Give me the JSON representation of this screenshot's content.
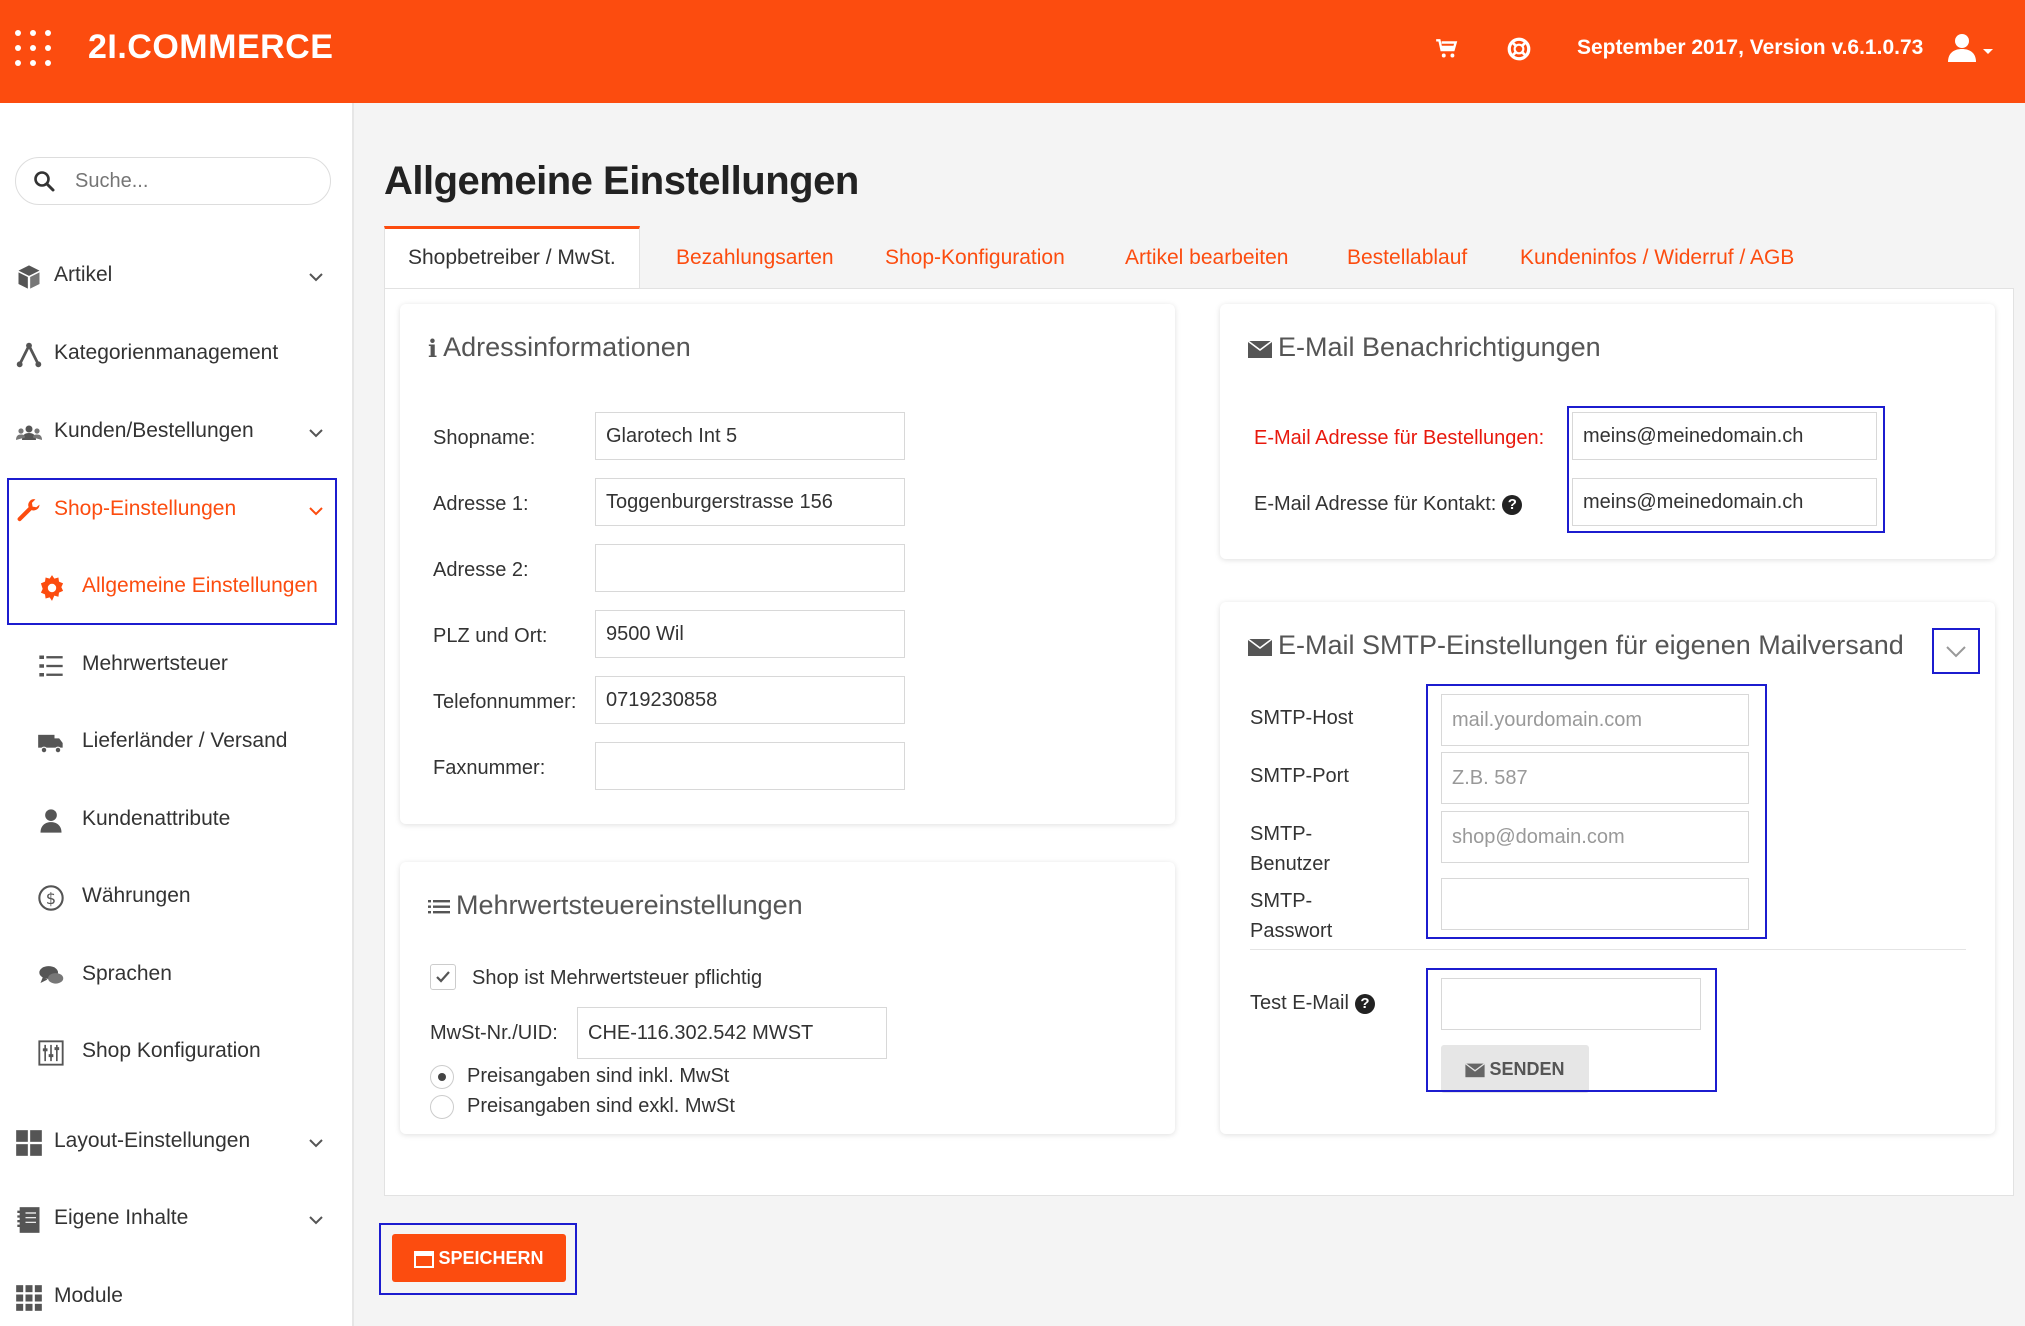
{
  "header": {
    "brand": "2I.COMMERCE",
    "version": "September 2017, Version v.6.1.0.73",
    "icons": [
      "grid-menu-icon",
      "cart-icon",
      "support-icon",
      "user-icon"
    ]
  },
  "sidebar": {
    "search_placeholder": "Suche...",
    "items": [
      {
        "label": "Artikel",
        "icon": "box-icon",
        "chevron": true
      },
      {
        "label": "Kategorienmanagement",
        "icon": "hierarchy-icon",
        "chevron": false
      },
      {
        "label": "Kunden/Bestellungen",
        "icon": "users-icon",
        "chevron": true
      },
      {
        "label": "Shop-Einstellungen",
        "icon": "wrench-icon",
        "chevron": true,
        "active": true
      },
      {
        "label": "Allgemeine Einstellungen",
        "icon": "gear-icon",
        "sub": true,
        "active": true
      },
      {
        "label": "Mehrwertsteuer",
        "icon": "list-icon",
        "sub": true
      },
      {
        "label": "Lieferländer / Versand",
        "icon": "truck-icon",
        "sub": true
      },
      {
        "label": "Kundenattribute",
        "icon": "person-icon",
        "sub": true
      },
      {
        "label": "Währungen",
        "icon": "dollar-icon",
        "sub": true
      },
      {
        "label": "Sprachen",
        "icon": "chat-icon",
        "sub": true
      },
      {
        "label": "Shop Konfiguration",
        "icon": "sliders-icon",
        "sub": true
      },
      {
        "label": "Layout-Einstellungen",
        "icon": "layout-icon",
        "chevron": true
      },
      {
        "label": "Eigene Inhalte",
        "icon": "notebook-icon",
        "chevron": true
      },
      {
        "label": "Module",
        "icon": "modules-icon",
        "chevron": false
      }
    ]
  },
  "page": {
    "title": "Allgemeine Einstellungen",
    "tabs": [
      "Shopbetreiber / MwSt.",
      "Bezahlungsarten",
      "Shop-Konfiguration",
      "Artikel bearbeiten",
      "Bestellablauf",
      "Kundeninfos / Widerruf / AGB"
    ]
  },
  "address": {
    "title": "Adressinformationen",
    "icon_glyph": "i",
    "shopname_label": "Shopname:",
    "shopname": "Glarotech Int 5",
    "adresse1_label": "Adresse 1:",
    "adresse1": "Toggenburgerstrasse 156",
    "adresse2_label": "Adresse 2:",
    "adresse2": "",
    "plz_label": "PLZ und Ort:",
    "plz": "9500 Wil",
    "tel_label": "Telefonnummer:",
    "tel": "0719230858",
    "fax_label": "Faxnummer:",
    "fax": ""
  },
  "vat": {
    "title": "Mehrwertsteuereinstellungen",
    "checkbox_label": "Shop ist Mehrwertsteuer pflichtig",
    "checked": true,
    "uid_label": "MwSt-Nr./UID:",
    "uid": "CHE-116.302.542 MWST",
    "radio_incl": "Preisangaben sind inkl. MwSt",
    "radio_excl": "Preisangaben sind exkl. MwSt",
    "selected": "incl"
  },
  "email": {
    "title": "E-Mail Benachrichtigungen",
    "orders_label": "E-Mail Adresse für Bestellungen:",
    "orders_value": "meins@meinedomain.ch",
    "contact_label": "E-Mail Adresse für Kontakt:",
    "contact_value": "meins@meinedomain.ch",
    "help_glyph": "?"
  },
  "smtp": {
    "title": "E-Mail SMTP-Einstellungen für eigenen Mailversand",
    "host_label": "SMTP-Host",
    "host_placeholder": "mail.yourdomain.com",
    "port_label": "SMTP-Port",
    "port_placeholder": "Z.B. 587",
    "user_label_1": "SMTP-",
    "user_label_2": "Benutzer",
    "user_placeholder": "shop@domain.com",
    "pass_label_1": "SMTP-",
    "pass_label_2": "Passwort",
    "test_label": "Test E-Mail",
    "send_button": "SENDEN"
  },
  "footer": {
    "save_button": "SPEICHERN"
  },
  "colors": {
    "brand": "#fc4c0f",
    "highlight": "#1c1ccf",
    "required_label": "#e8190d"
  }
}
